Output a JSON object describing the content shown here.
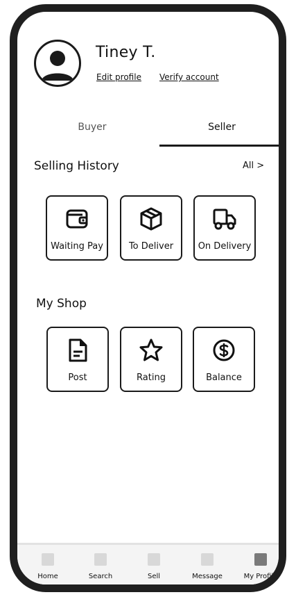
{
  "profile": {
    "name": "Tiney T.",
    "edit_link": "Edit profile",
    "verify_link": "Verify account"
  },
  "tabs": {
    "buyer": "Buyer",
    "seller": "Seller",
    "active": "Seller"
  },
  "selling_history": {
    "title": "Selling History",
    "all_link": "All >",
    "items": [
      {
        "label": "Waiting Pay",
        "icon": "wallet-icon"
      },
      {
        "label": "To Deliver",
        "icon": "box-icon"
      },
      {
        "label": "On Delivery",
        "icon": "truck-icon"
      }
    ]
  },
  "my_shop": {
    "title": "My Shop",
    "items": [
      {
        "label": "Post",
        "icon": "document-icon"
      },
      {
        "label": "Rating",
        "icon": "star-icon"
      },
      {
        "label": "Balance",
        "icon": "dollar-coin-icon"
      }
    ]
  },
  "bottom_nav": {
    "active": "My Profile",
    "items": [
      {
        "label": "Home"
      },
      {
        "label": "Search"
      },
      {
        "label": "Sell"
      },
      {
        "label": "Message"
      },
      {
        "label": "My Profile"
      }
    ]
  }
}
